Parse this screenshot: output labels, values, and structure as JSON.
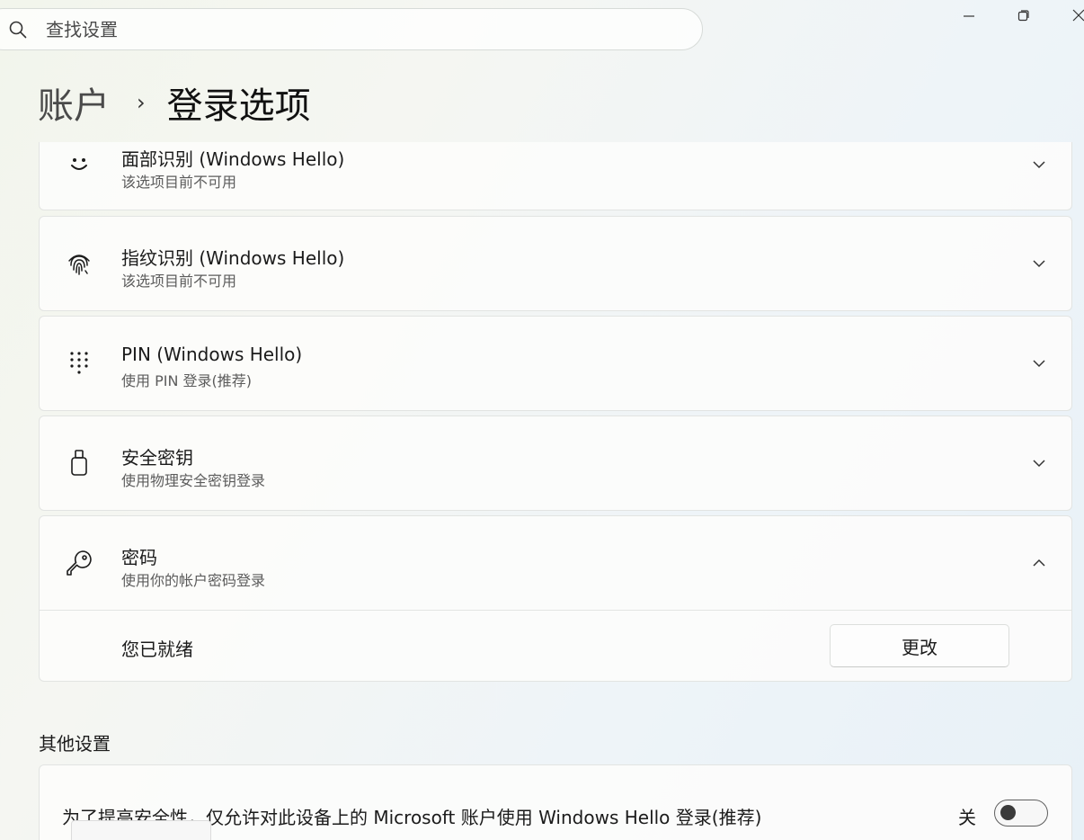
{
  "search": {
    "placeholder": "查找设置"
  },
  "window": {
    "minimize": "minimize",
    "restore": "restore",
    "close": "close"
  },
  "breadcrumb": {
    "parent": "账户",
    "separator": "›",
    "current": "登录选项"
  },
  "options": [
    {
      "icon": "face-icon",
      "title": "面部识别 (Windows Hello)",
      "subtitle": "该选项目前不可用",
      "expanded": false
    },
    {
      "icon": "fingerprint-icon",
      "title": "指纹识别 (Windows Hello)",
      "subtitle": "该选项目前不可用",
      "expanded": false
    },
    {
      "icon": "pin-keypad-icon",
      "title": "PIN (Windows Hello)",
      "subtitle": "使用 PIN 登录(推荐)",
      "expanded": false
    },
    {
      "icon": "security-key-icon",
      "title": "安全密钥",
      "subtitle": "使用物理安全密钥登录",
      "expanded": false
    },
    {
      "icon": "key-icon",
      "title": "密码",
      "subtitle": "使用你的帐户密码登录",
      "expanded": true
    }
  ],
  "password_panel": {
    "status": "您已就绪",
    "change_button": "更改"
  },
  "other_settings": {
    "heading": "其他设置",
    "hello_only": {
      "label": "为了提高安全性，仅允许对此设备上的 Microsoft 账户使用 Windows Hello 登录(推荐)",
      "state": "关",
      "on": false
    }
  },
  "colors": {
    "accent": "#1b1b1b",
    "card_bg": "#fcfcfb",
    "border": "#e2e4e2"
  }
}
